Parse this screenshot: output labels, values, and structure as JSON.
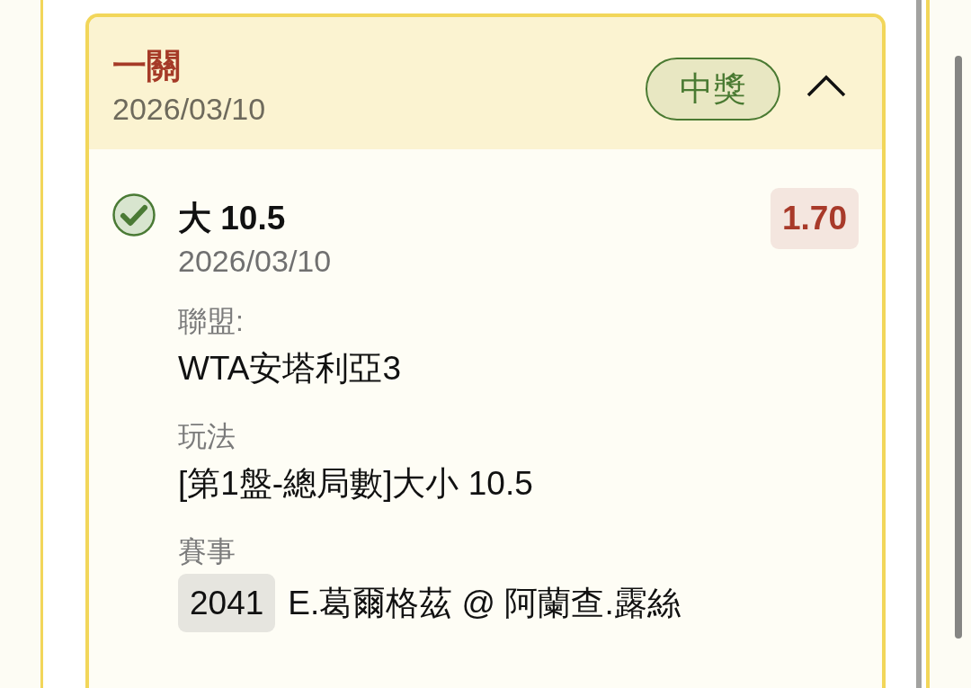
{
  "bet": {
    "type": "一關",
    "date": "2026/03/10",
    "status": {
      "label": "中獎",
      "won": true
    },
    "expanded": true,
    "legs": [
      {
        "won": true,
        "selection": "大 10.5",
        "date": "2026/03/10",
        "odds": "1.70",
        "fields": [
          {
            "label": "聯盟:",
            "value": "WTA安塔利亞3"
          },
          {
            "label": "玩法",
            "value": "[第1盤-總局數]大小 10.5"
          }
        ],
        "match": {
          "label": "賽事",
          "id": "2041",
          "teams": "E.葛爾格茲 @ 阿蘭查.露絲"
        }
      }
    ]
  }
}
